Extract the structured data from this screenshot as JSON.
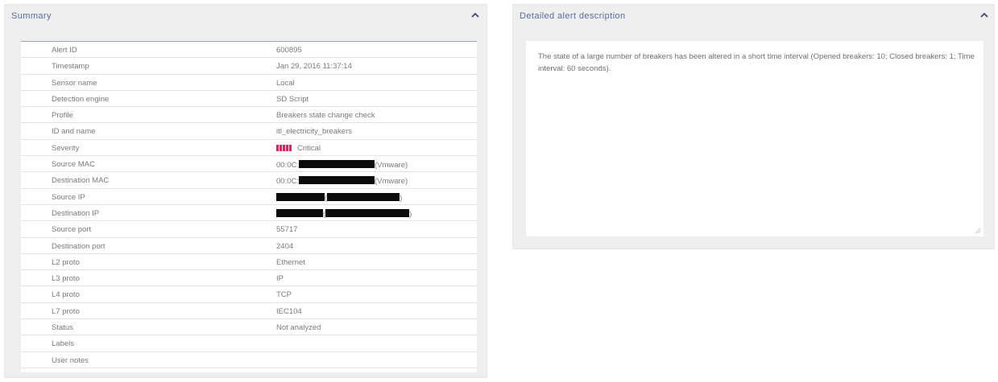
{
  "summary": {
    "title": "Summary",
    "collapse_icon": "chevron-up-icon",
    "rows": [
      {
        "label": "Alert ID",
        "value": "600895"
      },
      {
        "label": "Timestamp",
        "value": "Jan 29, 2016 11:37:14"
      },
      {
        "label": "Sensor name",
        "value": "Local"
      },
      {
        "label": "Detection engine",
        "value": "SD Script"
      },
      {
        "label": "Profile",
        "value": "Breakers state change check"
      },
      {
        "label": "ID and name",
        "value": "itl_electricity_breakers"
      },
      {
        "label": "Severity",
        "value": "Critical",
        "severity_bars": 5,
        "severity_color": "#e0245e"
      },
      {
        "label": "Source MAC",
        "value_prefix": "00:0C:",
        "value_suffix": "(Vmware)"
      },
      {
        "label": "Destination MAC",
        "value_prefix": "00:0C:",
        "value_suffix": "(Vmware)"
      },
      {
        "label": "Source IP",
        "value_prefix": "",
        "value_mid": "(",
        "value_suffix": ")"
      },
      {
        "label": "Destination IP",
        "value_prefix": "",
        "value_mid": "(",
        "value_suffix": ")"
      },
      {
        "label": "Source port",
        "value": "55717"
      },
      {
        "label": "Destination port",
        "value": "2404"
      },
      {
        "label": "L2 proto",
        "value": "Ethernet"
      },
      {
        "label": "L3 proto",
        "value": "IP"
      },
      {
        "label": "L4 proto",
        "value": "TCP"
      },
      {
        "label": "L7 proto",
        "value": "IEC104"
      },
      {
        "label": "Status",
        "value": "Not analyzed"
      },
      {
        "label": "Labels",
        "value": ""
      },
      {
        "label": "User notes",
        "value": ""
      }
    ]
  },
  "detail": {
    "title": "Detailed alert description",
    "collapse_icon": "chevron-up-icon",
    "text": "The state of a large number of breakers has been altered in a short time interval (Opened breakers: 10; Closed breakers: 1; Time interval: 60 seconds)."
  },
  "colors": {
    "panel_bg": "#eeeeee",
    "title_color": "#5a6da6",
    "severity": "#e0245e",
    "redaction": "#0b0b0b"
  }
}
